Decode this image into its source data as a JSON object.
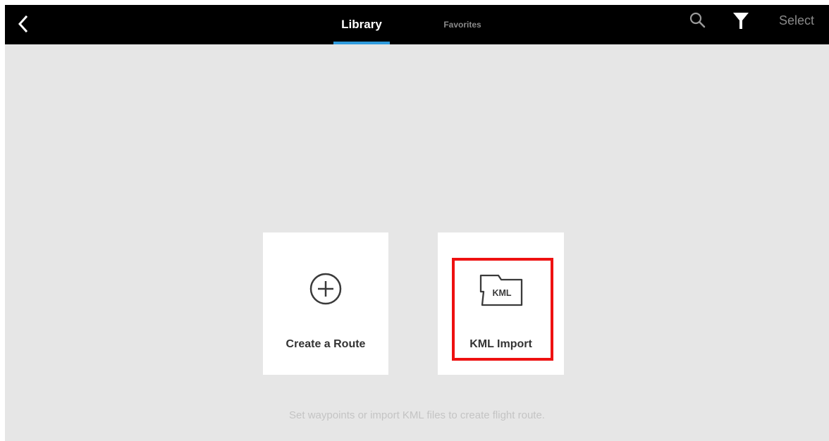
{
  "header": {
    "tabs": [
      {
        "label": "Library",
        "active": true
      },
      {
        "label": "Favorites",
        "active": false
      }
    ],
    "select_label": "Select",
    "icons": [
      "chevron-left-icon",
      "search-icon",
      "filter-icon"
    ],
    "accent_color": "#2f9bdd"
  },
  "main": {
    "cards": [
      {
        "label": "Create a Route",
        "icon": "plus-circle-icon"
      },
      {
        "label": "KML Import",
        "icon": "kml-folder-icon",
        "icon_text": "KML",
        "highlighted": true
      }
    ],
    "hint": "Set waypoints or import KML files to create flight route."
  },
  "colors": {
    "topbar": "#000000",
    "background": "#e6e6e6",
    "highlight": "#ee1111"
  }
}
